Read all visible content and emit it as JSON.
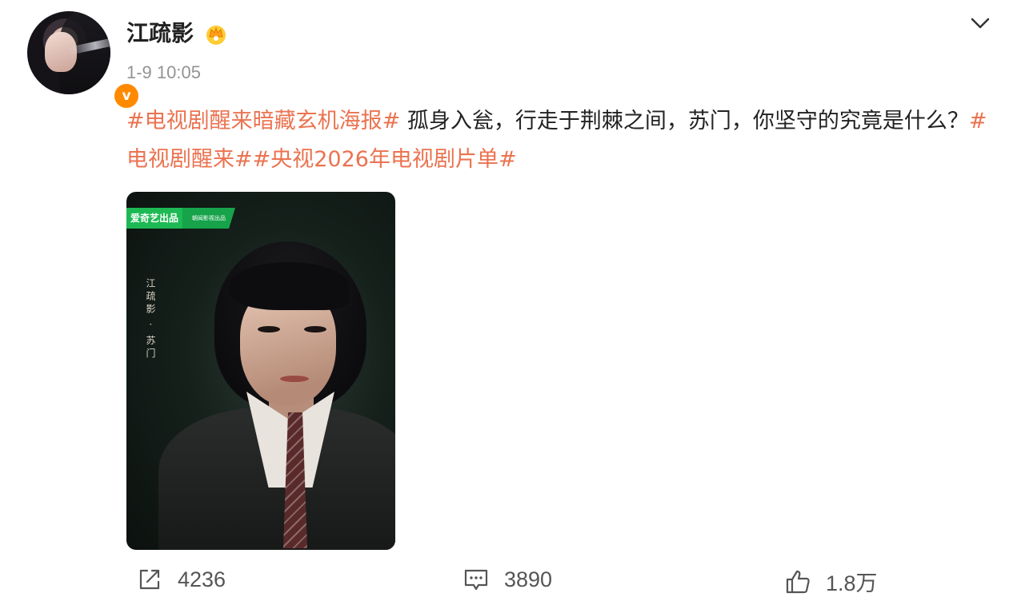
{
  "post": {
    "author": {
      "name": "江疏影",
      "verified": true,
      "badge_color": "#ff8a00"
    },
    "timestamp": "1-9 10:05",
    "content": [
      {
        "type": "hashtag",
        "text": "#电视剧醒来暗藏玄机海报#"
      },
      {
        "type": "text",
        "text": " 孤身入瓮，行走于荆棘之间，苏门，你坚守的究竟是什么？"
      },
      {
        "type": "hashtag",
        "text": "#电视剧醒来#"
      },
      {
        "type": "hashtag",
        "text": "#央视2026年电视剧片单#"
      }
    ],
    "image": {
      "logo_main": "爱奇艺出品",
      "logo_sub": "朝闻影视出品",
      "caption": "江疏影 · 苏门"
    },
    "actions": {
      "repost_count": "4236",
      "comment_count": "3890",
      "like_count": "1.8万"
    }
  },
  "colors": {
    "hashtag": "#eb7350",
    "muted": "#939393",
    "text": "#222222"
  },
  "icons": {
    "crown": "crown-icon",
    "menu": "chevron-down-icon",
    "repost": "repost-icon",
    "comment": "comment-icon",
    "like": "thumbs-up-icon"
  }
}
